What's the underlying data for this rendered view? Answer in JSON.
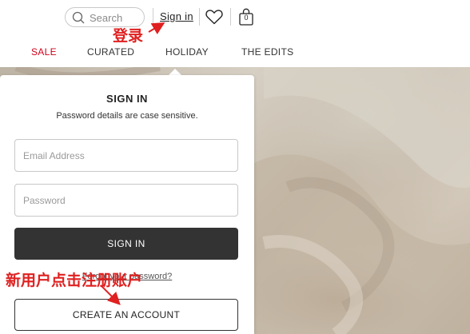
{
  "header": {
    "search": {
      "placeholder": "Search"
    },
    "sign_in_label": "Sign in",
    "bag_count": "0"
  },
  "nav": {
    "items": [
      {
        "label": "SALE",
        "color": "#d0021b"
      },
      {
        "label": "CURATED"
      },
      {
        "label": "HOLIDAY"
      },
      {
        "label": "THE EDITS"
      }
    ]
  },
  "signin_panel": {
    "title": "SIGN IN",
    "note": "Password details are case sensitive.",
    "email_placeholder": "Email Address",
    "password_placeholder": "Password",
    "submit_label": "SIGN IN",
    "forgot_label": "Forgot your password?",
    "create_account_label": "CREATE AN ACCOUNT"
  },
  "annotations": {
    "login_note": "登录",
    "register_note": "新用户点击注册账户",
    "color": "#e02020"
  },
  "icons": [
    "search-icon",
    "heart-icon",
    "shopping-bag-icon"
  ]
}
